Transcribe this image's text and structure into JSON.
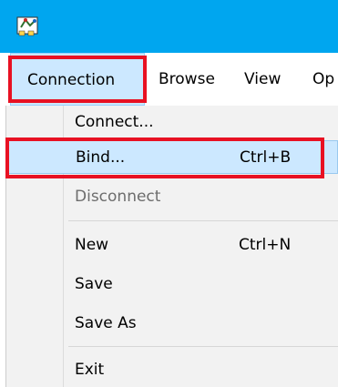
{
  "app": {
    "icon": "network-book-icon"
  },
  "menubar": {
    "items": [
      {
        "label": "Connection"
      },
      {
        "label": "Browse"
      },
      {
        "label": "View"
      },
      {
        "label": "Op"
      }
    ]
  },
  "dropdown": {
    "items": [
      {
        "label": "Connect...",
        "shortcut": ""
      },
      {
        "label": "Bind...",
        "shortcut": "Ctrl+B"
      },
      {
        "label": "Disconnect",
        "shortcut": ""
      },
      {
        "label": "New",
        "shortcut": "Ctrl+N"
      },
      {
        "label": "Save",
        "shortcut": ""
      },
      {
        "label": "Save As",
        "shortcut": ""
      },
      {
        "label": "Exit",
        "shortcut": ""
      }
    ]
  },
  "colors": {
    "titlebar": "#00a6ef",
    "highlight_box": "#e81123",
    "selection": "#cce8ff",
    "menu_background": "#f2f2f2",
    "disabled_text": "#6d6d6d"
  }
}
